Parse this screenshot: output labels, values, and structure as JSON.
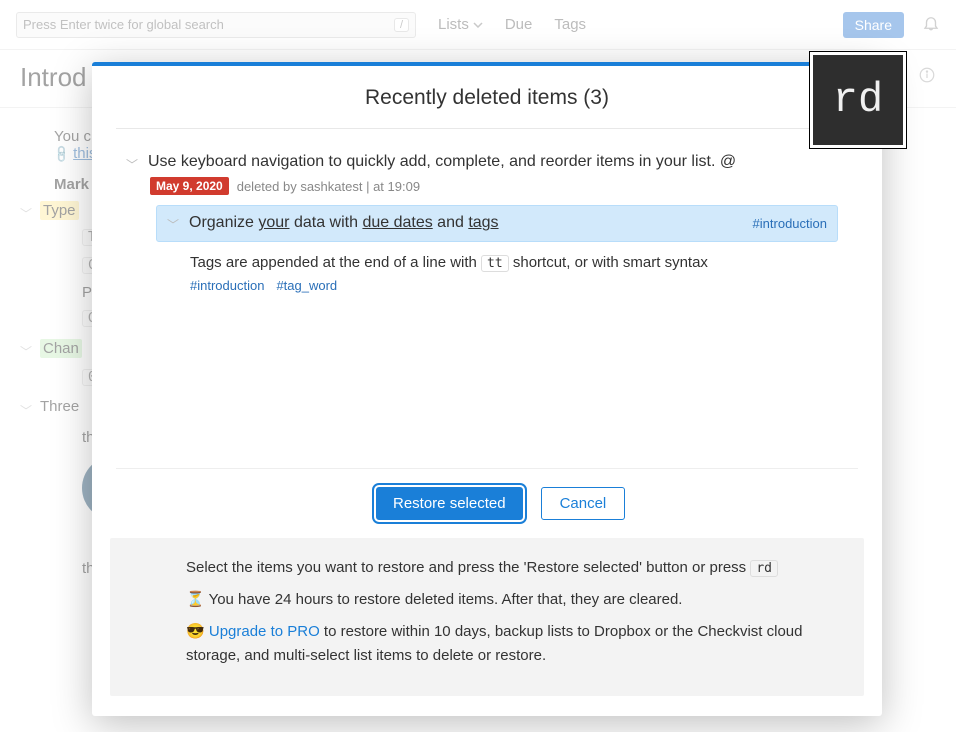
{
  "search": {
    "placeholder": "Press Enter twice for global search",
    "shortcut": "/"
  },
  "nav": {
    "lists": "Lists",
    "due": "Due",
    "tags": "Tags"
  },
  "topbar": {
    "share": "Share"
  },
  "page": {
    "title": "Introd"
  },
  "bg": {
    "line1_a": "You c",
    "line2_a": "this",
    "mark_label": "Mark",
    "type_label": "Type",
    "kbd_t": "T",
    "kbd_c": "C",
    "pr_label": "Pr",
    "kbd_g": "G",
    "chan_label": "Chan",
    "kbd_0": "0",
    "three_label": "Three",
    "th1": "th",
    "th2": "th"
  },
  "modal": {
    "title": "Recently deleted items (3)",
    "item1_text": "Use keyboard navigation to quickly add, complete, and reorder items in your list. @",
    "item1_date": "May 9, 2020",
    "item1_meta": "deleted by sashkatest | at 19:09",
    "item2_a": "Organize ",
    "item2_your": "your",
    "item2_b": " data with ",
    "item2_due": "due dates",
    "item2_c": " and ",
    "item2_tags": "tags",
    "item2_tag": "#introduction",
    "item3_a": "Tags are appended at the end of a line with ",
    "item3_kbd": "tt",
    "item3_b": " shortcut, or with smart syntax",
    "item3_tag1": "#introduction",
    "item3_tag2": "#tag_word",
    "restore_btn": "Restore selected",
    "cancel_btn": "Cancel",
    "info_p1_a": "Select the items you want to restore and press the 'Restore selected' button or press ",
    "info_p1_kbd": "rd",
    "info_p2": "⏳ You have 24 hours to restore deleted items. After that, they are cleared.",
    "info_p3_a": "😎 ",
    "info_p3_link": "Upgrade to PRO",
    "info_p3_b": " to restore within 10 days, backup lists to Dropbox or the Checkvist cloud storage, and multi-select list items to delete or restore."
  },
  "rd_badge": "rd"
}
